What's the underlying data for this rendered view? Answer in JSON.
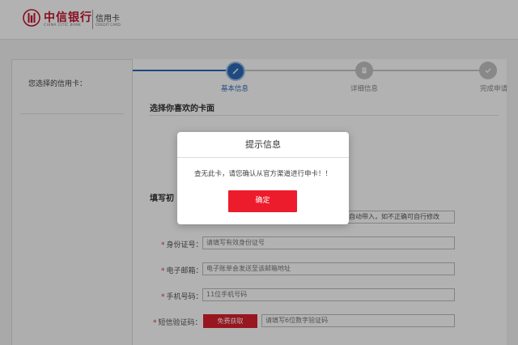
{
  "header": {
    "logo_cn": "中信银行",
    "logo_en": "CHINA CITIC BANK",
    "sub_title": "信用卡",
    "sub_title_en": "CREDIT CARD"
  },
  "sidebar": {
    "title": "您选择的信用卡："
  },
  "steps": [
    {
      "label": "基本信息",
      "state": "active",
      "icon": "pencil-icon"
    },
    {
      "label": "详细信息",
      "state": "pending",
      "icon": "document-icon"
    },
    {
      "label": "完成申请",
      "state": "pending",
      "icon": "check-icon"
    }
  ],
  "sections": {
    "card_face": "选择你喜欢的卡面",
    "fill_info": "填写初"
  },
  "form": {
    "name_hint": "为自动带入，如不正确可自行修改",
    "fields": [
      {
        "label": "身份证号：",
        "placeholder": "请填写有效身份证号"
      },
      {
        "label": "电子邮箱：",
        "placeholder": "电子账单会发送至该邮箱地址"
      },
      {
        "label": "手机号码：",
        "placeholder": "11位手机号码"
      },
      {
        "label": "短信验证码：",
        "placeholder": "请填写6位数字验证码"
      }
    ],
    "sms_button": "免费获取"
  },
  "modal": {
    "title": "提示信息",
    "message": "查无此卡，请您确认从官方渠道进行申卡！！",
    "confirm": "确定"
  },
  "colors": {
    "brand_red": "#c3132d",
    "step_blue": "#2b6bb8",
    "button_red": "#ec1c2d"
  }
}
